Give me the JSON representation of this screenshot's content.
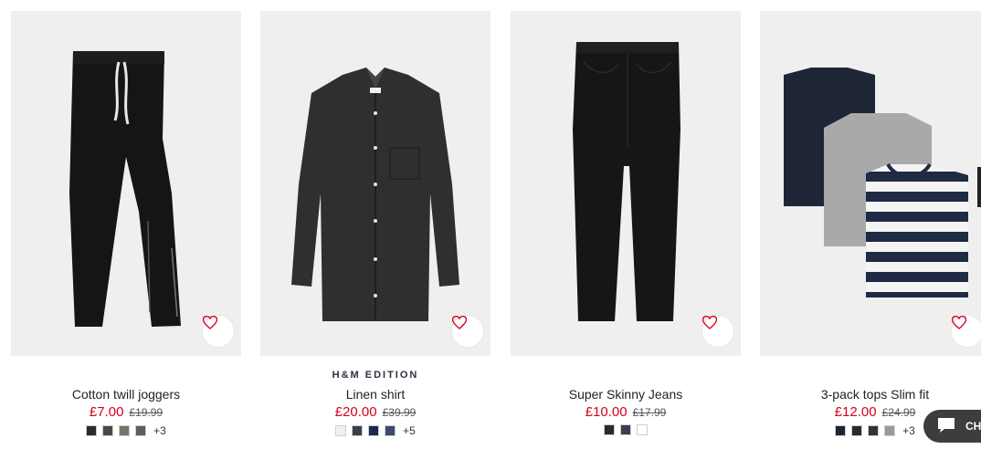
{
  "products": [
    {
      "edition": "",
      "title": "Cotton twill joggers",
      "price": "£7.00",
      "old_price": "£19.99",
      "swatches": [
        "#2b2b2b",
        "#4a4a44",
        "#7a7568",
        "#5e5e58"
      ],
      "more": "+3"
    },
    {
      "edition": "H&M EDITION",
      "title": "Linen shirt",
      "price": "£20.00",
      "old_price": "£39.99",
      "swatches": [
        "#f2f0ea",
        "#3a3f4a",
        "#1b2a4e",
        "#3c4a6e"
      ],
      "more": "+5"
    },
    {
      "edition": "",
      "title": "Super Skinny Jeans",
      "price": "£10.00",
      "old_price": "£17.99",
      "swatches": [
        "#2a2a2a",
        "#36414f",
        "#ffffff"
      ],
      "more": ""
    },
    {
      "edition": "",
      "title": "3-pack tops Slim fit",
      "price": "£12.00",
      "old_price": "£24.99",
      "swatches": [
        "#1f2533",
        "#2a2a2a",
        "#333333",
        "#9a9a9a"
      ],
      "more": "+3"
    }
  ],
  "chat": {
    "label": "CH"
  },
  "colors": {
    "sale": "#d6001c",
    "heart": "#d6001c"
  }
}
